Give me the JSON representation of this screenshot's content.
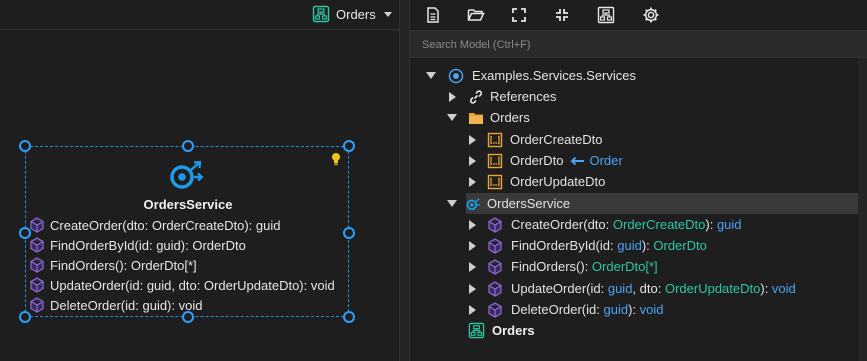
{
  "left_panel": {
    "diagram_selector": {
      "label": "Orders",
      "icon": "diagram-icon"
    },
    "node": {
      "title": "OrdersService",
      "icon": "service-icon",
      "hint_icon": "lightbulb-icon",
      "operations": [
        "CreateOrder(dto: OrderCreateDto): guid",
        "FindOrderById(id: guid): OrderDto",
        "FindOrders(): OrderDto[*]",
        "UpdateOrder(id: guid, dto: OrderUpdateDto): void",
        "DeleteOrder(id: guid): void"
      ]
    }
  },
  "right_panel": {
    "toolbar": {
      "buttons": [
        "new-document-icon",
        "open-folder-icon",
        "expand-icon",
        "collapse-icon",
        "diagram-icon",
        "settings-gear-icon"
      ]
    },
    "search": {
      "placeholder": "Search Model (Ctrl+F)",
      "value": ""
    },
    "tree": {
      "root": "Examples.Services.Services",
      "references": "References",
      "orders_folder": "Orders",
      "dtos": [
        "OrderCreateDto",
        "OrderDto",
        "OrderUpdateDto"
      ],
      "order_dto_link": "Order",
      "service": "OrdersService",
      "ops": {
        "create": {
          "name": "CreateOrder(",
          "p1": "dto",
          "colon1": ": ",
          "t1": "OrderCreateDto",
          "close": "): ",
          "ret": "guid"
        },
        "find_by_id": {
          "name": "FindOrderById(",
          "p1": "id",
          "colon1": ": ",
          "t1": "guid",
          "close": "): ",
          "ret": "OrderDto"
        },
        "find_all": {
          "name": "FindOrders(",
          "close": "): ",
          "ret": "OrderDto[*]"
        },
        "update": {
          "name": "UpdateOrder(",
          "p1": "id",
          "colon1": ": ",
          "t1": "guid",
          "sep": ", ",
          "p2": "dto",
          "colon2": ": ",
          "t2": "OrderUpdateDto",
          "close": "): ",
          "ret": "void"
        },
        "delete": {
          "name": "DeleteOrder(",
          "p1": "id",
          "colon1": ": ",
          "t1": "guid",
          "close": "): ",
          "ret": "void"
        }
      },
      "diagram": "Orders"
    }
  },
  "colors": {
    "accent_blue": "#2aa1ff",
    "type_teal": "#2dc7a6",
    "keyword_blue": "#4aa3f3",
    "folder_orange": "#e8a33a",
    "op_purple": "#8f6bd8"
  }
}
